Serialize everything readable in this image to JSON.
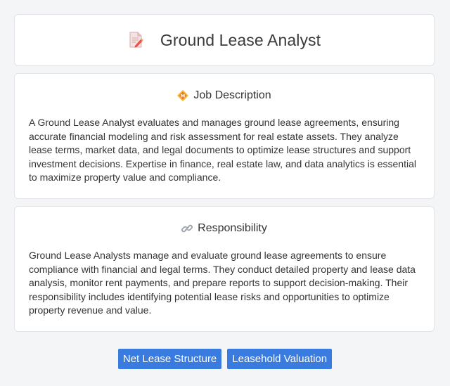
{
  "header": {
    "title": "Ground Lease Analyst",
    "icon": "document-pen-icon"
  },
  "job_description": {
    "heading": "Job Description",
    "icon": "diamond-badge-icon",
    "text": "A Ground Lease Analyst evaluates and manages ground lease agreements, ensuring accurate financial modeling and risk assessment for real estate assets. They analyze lease terms, market data, and legal documents to optimize lease structures and support investment decisions. Expertise in finance, real estate law, and data analytics is essential to maximize property value and compliance."
  },
  "responsibility": {
    "heading": "Responsibility",
    "icon": "link-icon",
    "text": "Ground Lease Analysts manage and evaluate ground lease agreements to ensure compliance with financial and legal terms. They conduct detailed property and lease data analysis, monitor rent payments, and prepare reports to support decision-making. Their responsibility includes identifying potential lease risks and opportunities to optimize property revenue and value."
  },
  "tags": [
    {
      "label": "Net Lease Structure"
    },
    {
      "label": "Leasehold Valuation"
    }
  ],
  "colors": {
    "tag_background": "#3a7be0",
    "page_background": "#f4f5f7"
  }
}
